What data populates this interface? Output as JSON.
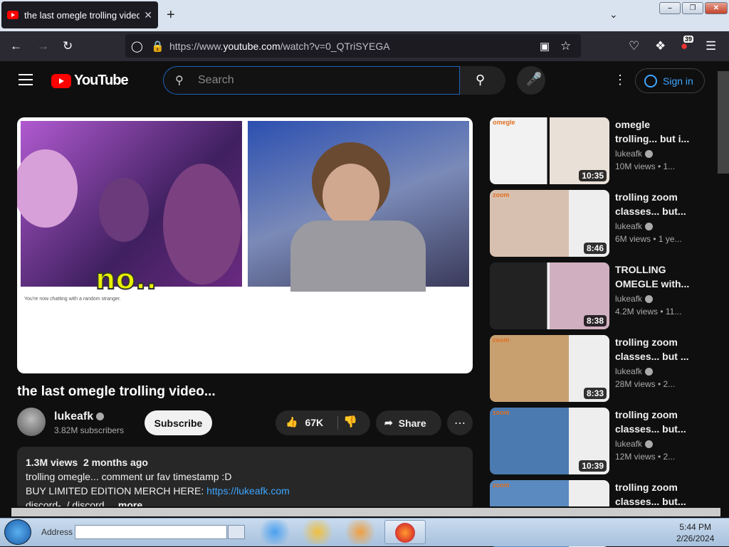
{
  "browser": {
    "tab_title": "the last omegle trolling video...",
    "url_prefix": "https://www.",
    "url_domain": "youtube.com",
    "url_path": "/watch?v=0_QTriSYEGA",
    "extension_badge": "39",
    "icons": [
      "back-icon",
      "forward-icon",
      "reload-icon",
      "shield-icon",
      "lock-icon",
      "picture-in-picture-icon",
      "bookmark-star-icon",
      "pocket-icon",
      "extensions-icon",
      "hamburger-menu-icon"
    ]
  },
  "header": {
    "logo_text": "YouTube",
    "search_placeholder": "Search",
    "signin_label": "Sign in"
  },
  "player": {
    "caption": "no..",
    "chat_status": "You're now chatting with a random stranger."
  },
  "video": {
    "title": "the last omegle trolling video...",
    "channel": "lukeafk",
    "subscribers": "3.82M subscribers",
    "subscribe_label": "Subscribe",
    "likes": "67K",
    "share_label": "Share",
    "views": "1.3M views",
    "age": "2 months ago",
    "desc_line1": "trolling omegle... comment ur fav timestamp :D",
    "desc_line2_prefix": "BUY LIMITED EDITION MERCH HERE: ",
    "desc_link": "https://lukeafk.com",
    "desc_line3": "discord-  / discord",
    "more_label": "...more"
  },
  "recommendations": [
    {
      "title1": "omegle",
      "title2": "trolling... but i...",
      "channel": "lukeafk",
      "meta": "10M views  • 1...",
      "duration": "10:35",
      "thumb_label": "omegle"
    },
    {
      "title1": "trolling zoom",
      "title2": "classes... but...",
      "channel": "lukeafk",
      "meta": "6M views  • 1 ye...",
      "duration": "8:46",
      "thumb_label": "zoom"
    },
    {
      "title1": "TROLLING",
      "title2": "OMEGLE with...",
      "channel": "lukeafk",
      "meta": "4.2M views  • 11...",
      "duration": "8:38",
      "thumb_label": ""
    },
    {
      "title1": "trolling zoom",
      "title2": "classes... but ...",
      "channel": "lukeafk",
      "meta": "28M views  • 2...",
      "duration": "8:33",
      "thumb_label": "zoom"
    },
    {
      "title1": "trolling zoom",
      "title2": "classes... but...",
      "channel": "lukeafk",
      "meta": "12M views  • 2...",
      "duration": "10:39",
      "thumb_label": "zoom"
    },
    {
      "title1": "trolling zoom",
      "title2": "classes... but...",
      "channel": "",
      "meta": "",
      "duration": "",
      "thumb_label": "zoom"
    }
  ],
  "taskbar": {
    "address_label": "Address",
    "time": "5:44 PM",
    "date": "2/26/2024"
  }
}
